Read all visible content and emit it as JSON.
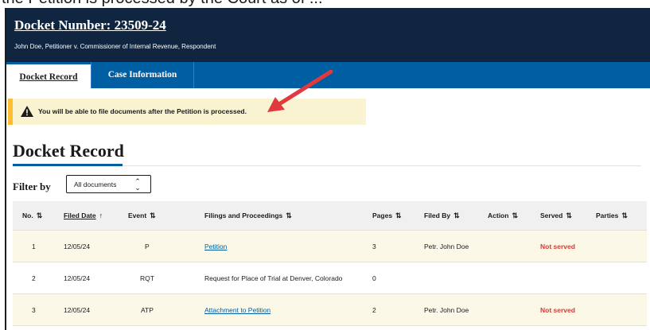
{
  "top_strip_text": "the Petition is processed by the Court as of ...",
  "header": {
    "docket_number": "Docket Number: 23509-24",
    "caption": "John Doe, Petitioner v. Commissioner of Internal Revenue, Respondent"
  },
  "tabs": [
    {
      "label": "Docket Record",
      "active": true
    },
    {
      "label": "Case Information",
      "active": false
    }
  ],
  "alert": {
    "icon": "warning-icon",
    "text": "You will be able to file documents after the Petition is processed."
  },
  "section_title": "Docket Record",
  "filter": {
    "label": "Filter by",
    "selected": "All documents"
  },
  "columns": [
    {
      "label": "No.",
      "sort": "⇅"
    },
    {
      "label": "Filed Date",
      "sort": "↑"
    },
    {
      "label": "Event",
      "sort": "⇅"
    },
    {
      "label": "Filings and Proceedings",
      "sort": "⇅"
    },
    {
      "label": "Pages",
      "sort": "⇅"
    },
    {
      "label": "Filed By",
      "sort": "⇅"
    },
    {
      "label": "Action",
      "sort": "⇅"
    },
    {
      "label": "Served",
      "sort": "⇅"
    },
    {
      "label": "Parties",
      "sort": "⇅"
    }
  ],
  "rows": [
    {
      "no": "1",
      "date": "12/05/24",
      "event": "P",
      "filing": "Petition",
      "pages": "3",
      "filed_by": "Petr. John Doe",
      "action": "",
      "served": "Not served",
      "parties": ""
    },
    {
      "no": "2",
      "date": "12/05/24",
      "event": "RQT",
      "filing": "Request for Place of Trial at Denver, Colorado",
      "pages": "0",
      "filed_by": "",
      "action": "",
      "served": "",
      "parties": ""
    },
    {
      "no": "3",
      "date": "12/05/24",
      "event": "ATP",
      "filing": "Attachment to Petition",
      "pages": "2",
      "filed_by": "Petr. John Doe",
      "action": "",
      "served": "Not served",
      "parties": ""
    }
  ],
  "colors": {
    "header_bg": "#0f2540",
    "tab_bar": "#005ea2",
    "alert_bg": "#faf3d1",
    "alert_border": "#ffbe2e",
    "link": "#005ea2",
    "not_served": "#d83933",
    "highlight_row": "#fcf8e8",
    "annotation_arrow": "#e0393e"
  }
}
